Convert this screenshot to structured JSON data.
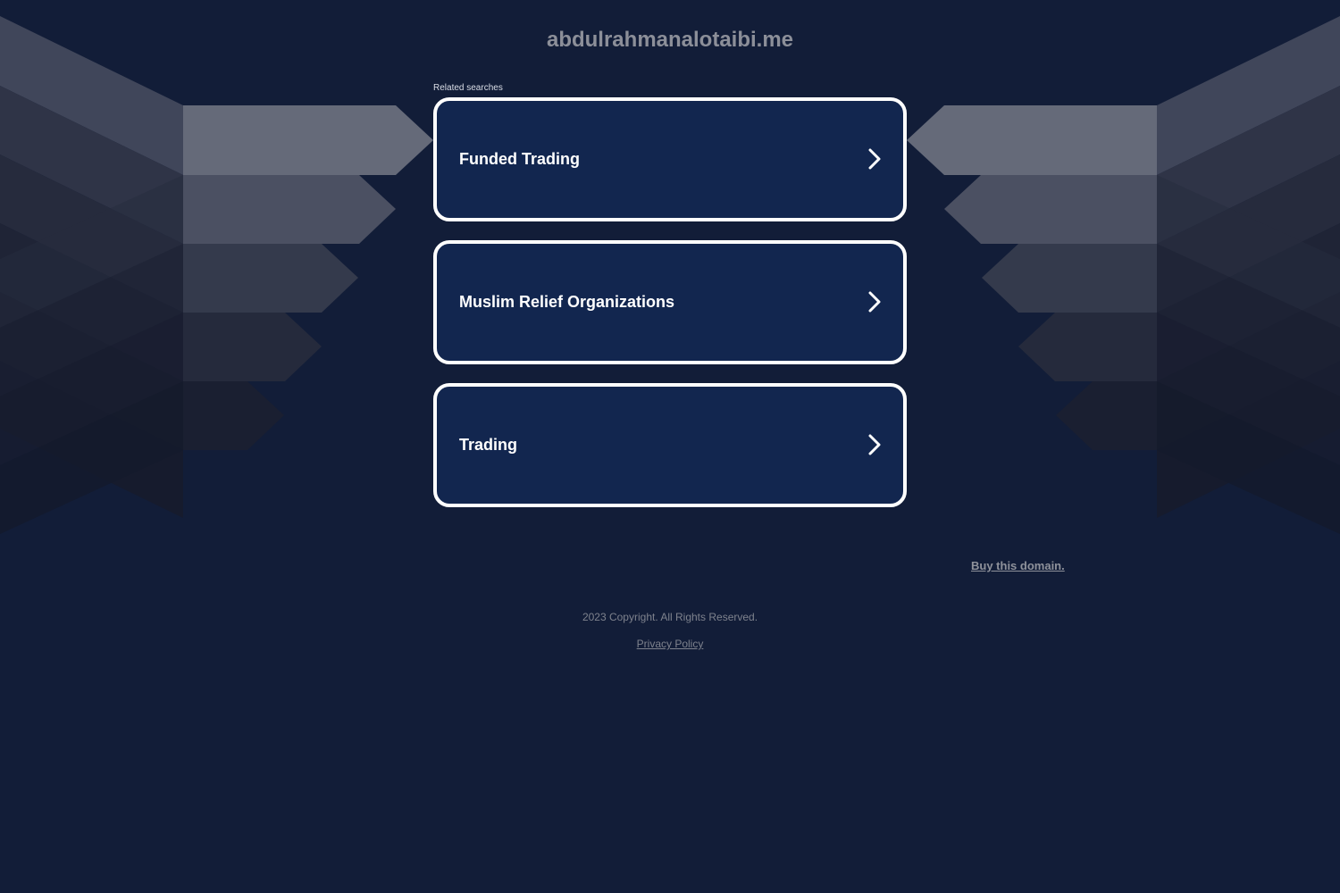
{
  "domain": {
    "title": "abdulrahmanalotaibi.me"
  },
  "related": {
    "label": "Related searches",
    "items": [
      {
        "label": "Funded Trading",
        "icon": "chevron-right-icon"
      },
      {
        "label": "Muslim Relief Organizations",
        "icon": "chevron-right-icon"
      },
      {
        "label": "Trading",
        "icon": "chevron-right-icon"
      }
    ]
  },
  "buy": {
    "label": "Buy this domain."
  },
  "footer": {
    "copyright": "2023 Copyright. All Rights Reserved.",
    "privacy_label": "Privacy Policy"
  },
  "colors": {
    "background": "#121d38",
    "card_background": "#12264f",
    "card_border": "#ffffff",
    "muted_text": "#8c8f99"
  }
}
